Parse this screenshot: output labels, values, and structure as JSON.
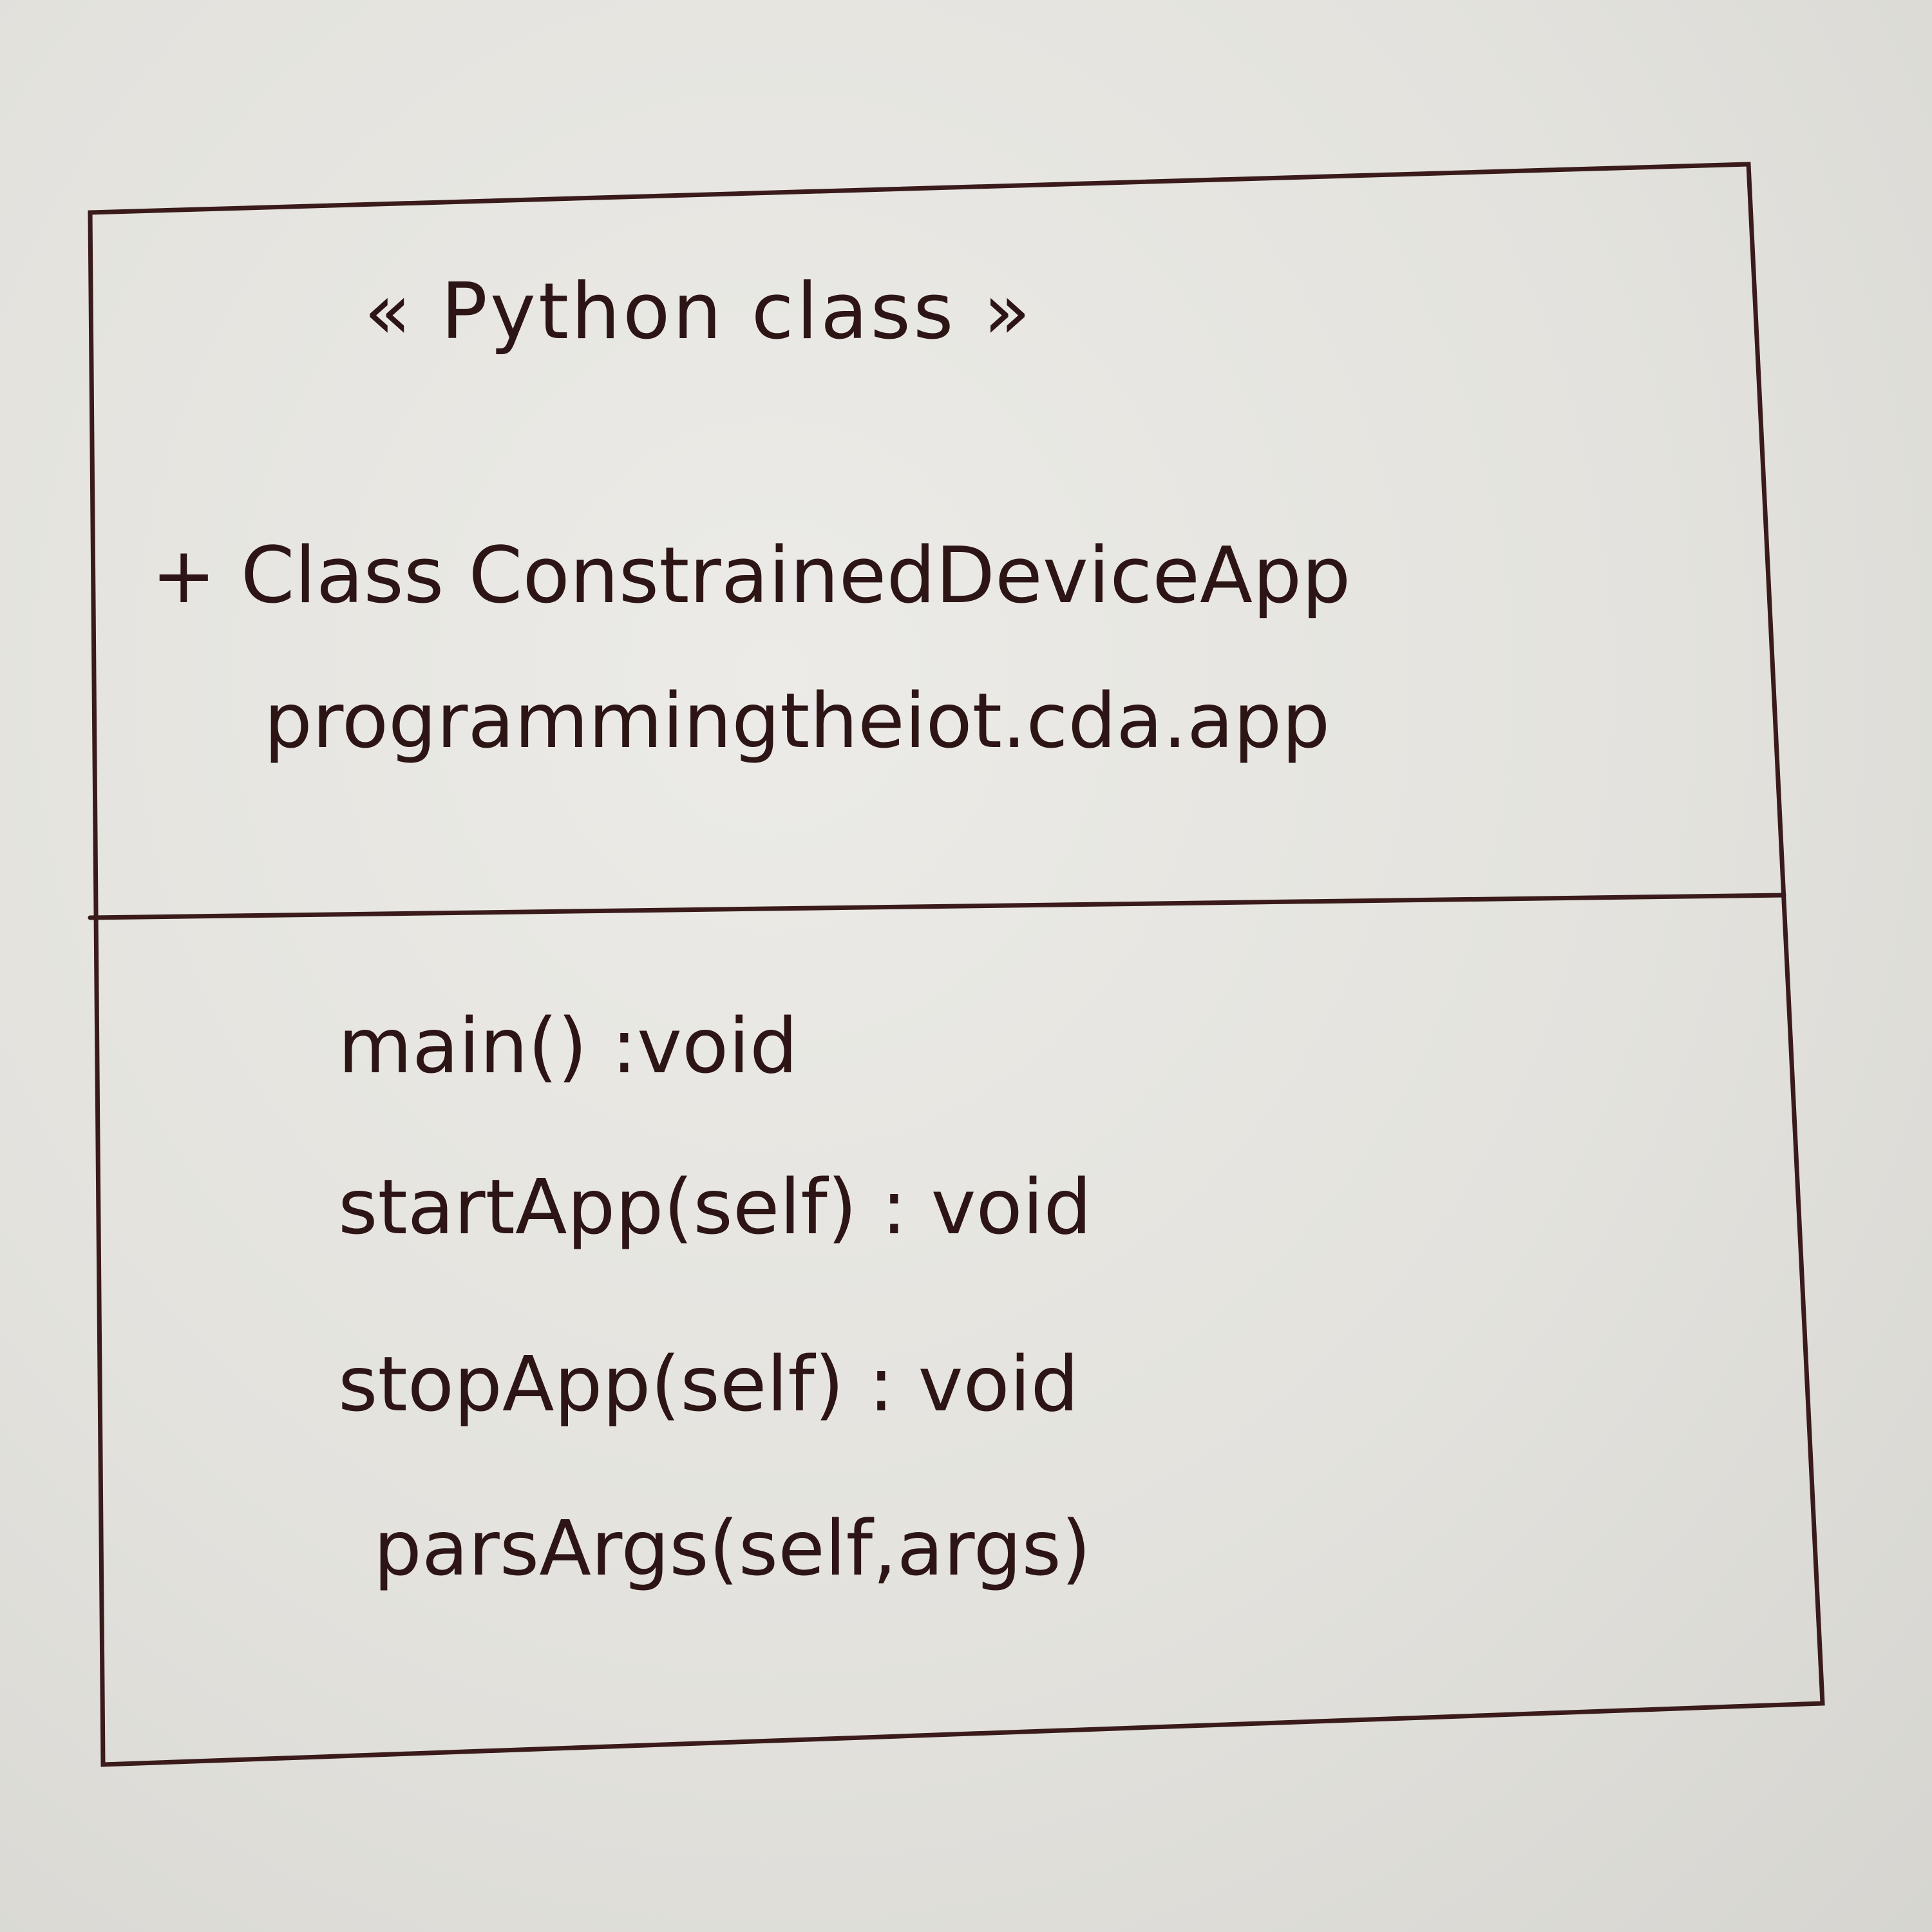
{
  "diagram": {
    "stereotype": "« Python class »",
    "class_declaration": "+ Class ConstrainedDeviceApp",
    "package": "programmingtheiot.cda.app",
    "methods": [
      "main() :void",
      "startApp(self) : void",
      "stopApp(self) : void",
      "parsArgs(self,args)"
    ]
  },
  "colors": {
    "ink": "#2e1515",
    "paper": "#e4e3de"
  }
}
